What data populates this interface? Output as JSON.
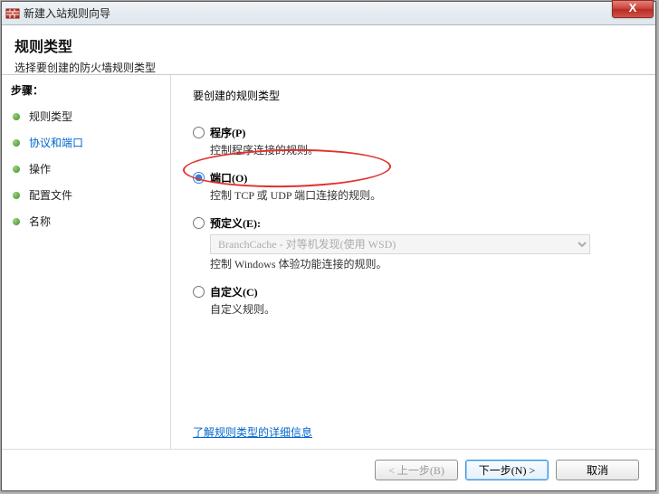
{
  "window": {
    "title": "新建入站规则向导",
    "close_glyph": "X"
  },
  "header": {
    "title": "规则类型",
    "subtitle": "选择要创建的防火墙规则类型"
  },
  "sidebar": {
    "steps_label": "步骤：",
    "items": [
      {
        "label": "规则类型"
      },
      {
        "label": "协议和端口"
      },
      {
        "label": "操作"
      },
      {
        "label": "配置文件"
      },
      {
        "label": "名称"
      }
    ],
    "active_index": 1
  },
  "main": {
    "prompt": "要创建的规则类型",
    "options": [
      {
        "key": "program",
        "title": "程序(P)",
        "desc": "控制程序连接的规则。",
        "checked": false
      },
      {
        "key": "port",
        "title": "端口(O)",
        "desc": "控制 TCP 或 UDP 端口连接的规则。",
        "checked": true
      },
      {
        "key": "predefined",
        "title": "预定义(E):",
        "desc_below_select": "控制 Windows 体验功能连接的规则。",
        "checked": false,
        "select_value": "BranchCache - 对等机发现(使用 WSD)"
      },
      {
        "key": "custom",
        "title": "自定义(C)",
        "desc": "自定义规则。",
        "checked": false
      }
    ],
    "learn_more": "了解规则类型的详细信息"
  },
  "footer": {
    "back": "< 上一步(B)",
    "next": "下一步(N) >",
    "cancel": "取消"
  }
}
